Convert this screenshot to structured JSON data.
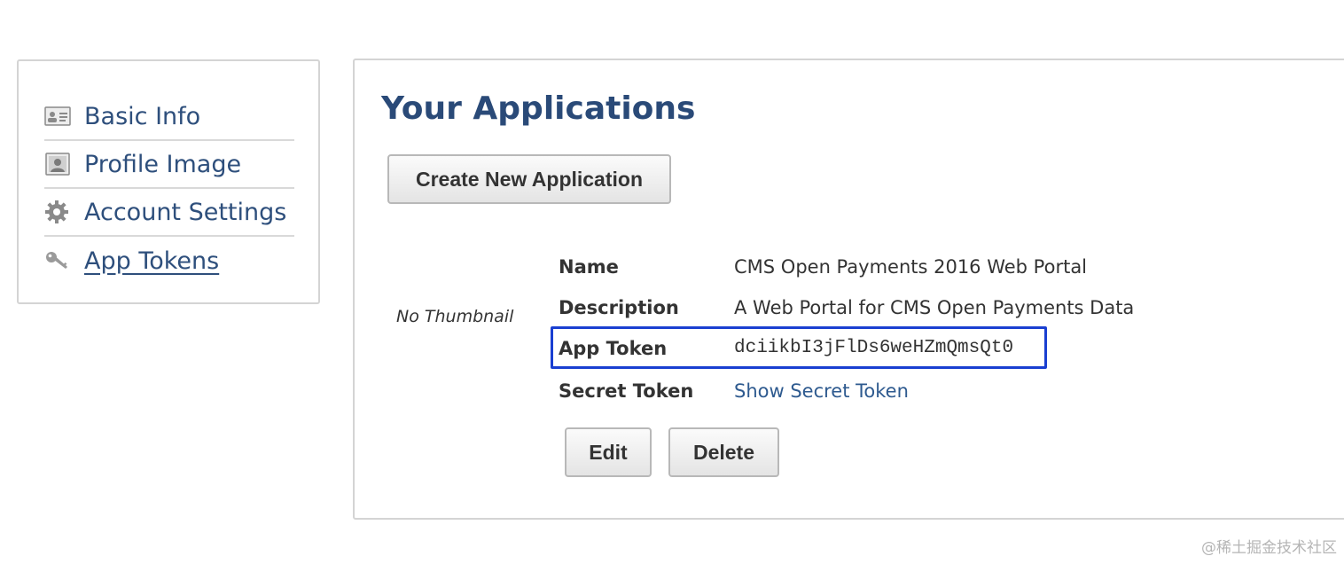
{
  "sidebar": {
    "items": [
      {
        "label": "Basic Info",
        "icon": "id-card-icon"
      },
      {
        "label": "Profile Image",
        "icon": "portrait-icon"
      },
      {
        "label": "Account Settings",
        "icon": "gear-icon"
      },
      {
        "label": "App Tokens",
        "icon": "key-icon",
        "active": true
      }
    ]
  },
  "main": {
    "title": "Your Applications",
    "create_button": "Create New Application",
    "thumbnail": "No Thumbnail",
    "details": {
      "name_label": "Name",
      "name_value": "CMS Open Payments 2016 Web Portal",
      "description_label": "Description",
      "description_value": "A Web Portal for CMS Open Payments Data",
      "token_label": "App Token",
      "token_value": "dciikbI3jFlDs6weHZmQmsQt0",
      "secret_label": "Secret Token",
      "secret_link": "Show Secret Token"
    },
    "edit_button": "Edit",
    "delete_button": "Delete"
  },
  "watermark": "@稀土掘金技术社区",
  "colors": {
    "link": "#2e4f7c",
    "title": "#2a4a78",
    "highlight": "#1a3fd1"
  }
}
